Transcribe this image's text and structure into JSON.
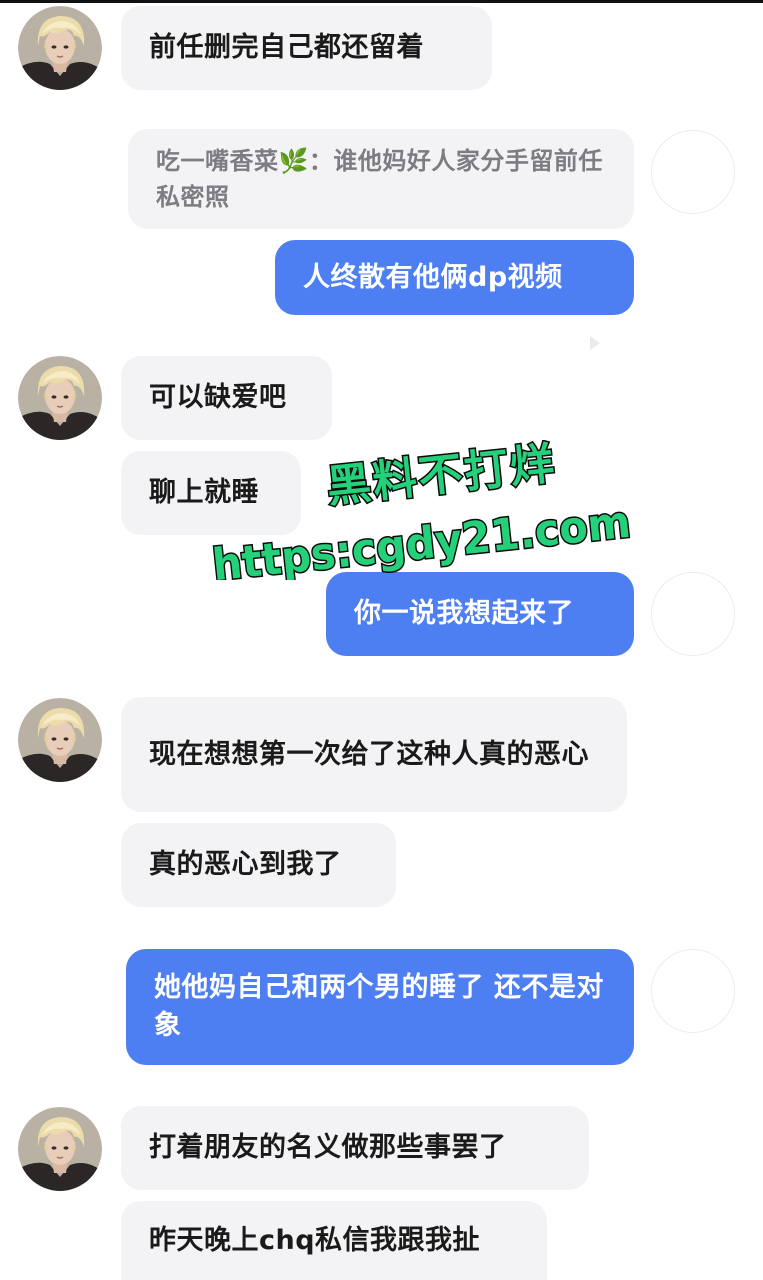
{
  "messages": {
    "m1": "前任删完自己都还留着",
    "m2_quote_author": "吃一嘴香菜",
    "m2_quote_emoji": "🌿",
    "m2_quote_text": "谁他妈好人家分手留前任私密照",
    "m3": "人终散有他俩dp视频",
    "m4": "可以缺爱吧",
    "m5": "聊上就睡",
    "m6": "你一说我想起来了",
    "m7": "现在想想第一次给了这种人真的恶心",
    "m8": "真的恶心到我了",
    "m9": "她他妈自己和两个男的睡了 还不是对象",
    "m10": "打着朋友的名义做那些事罢了",
    "m11": "昨天晚上chq私信我跟我扯"
  },
  "watermark": {
    "line1": "黑料不打烊",
    "line2": "https:cgdy21.com"
  },
  "colors": {
    "sent_bubble": "#4d7ef2",
    "received_bubble": "#f3f3f5",
    "watermark_fill": "#25d07a",
    "watermark_stroke": "#0a0a0a"
  },
  "icons": {
    "contact_avatar": "blond-hair-avatar",
    "self_avatar": "blank-avatar"
  }
}
